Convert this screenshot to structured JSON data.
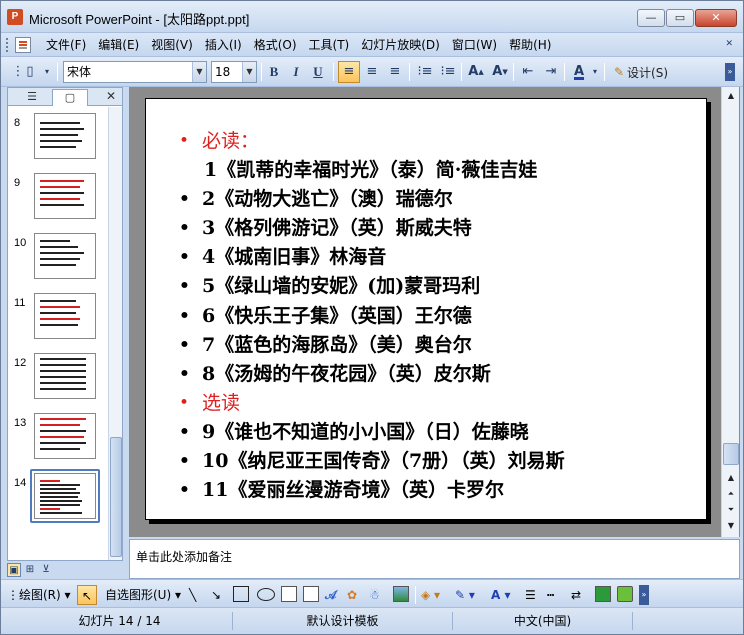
{
  "window": {
    "title": "Microsoft PowerPoint - [太阳路ppt.ppt]",
    "app_icon": "P",
    "controls": {
      "minimize": "—",
      "maximize": "▭",
      "close": "✕"
    }
  },
  "menu": {
    "items": [
      "文件(F)",
      "编辑(E)",
      "视图(V)",
      "插入(I)",
      "格式(O)",
      "工具(T)",
      "幻灯片放映(D)",
      "窗口(W)",
      "帮助(H)"
    ]
  },
  "toolbar": {
    "font": "宋体",
    "size": "18",
    "bold": "B",
    "italic": "I",
    "underline": "U",
    "design_label": "设计(S)",
    "font_color": "#1f3fb0"
  },
  "left_panel": {
    "tab_outline_icon": "outline-icon",
    "tab_slides_icon": "slides-icon",
    "close": "✕",
    "thumbnails": [
      {
        "num": "8"
      },
      {
        "num": "9"
      },
      {
        "num": "10"
      },
      {
        "num": "11"
      },
      {
        "num": "12"
      },
      {
        "num": "13"
      },
      {
        "num": "14",
        "selected": true
      }
    ]
  },
  "slide": {
    "lines": [
      {
        "text": "必读：",
        "style": "red"
      },
      {
        "text": "1《凯蒂的幸福时光》（泰）简·薇佳吉娃",
        "style": "nodot"
      },
      {
        "text": "2《动物大逃亡》（澳）瑞德尔",
        "style": "bullet"
      },
      {
        "text": "3《格列佛游记》（英）斯威夫特",
        "style": "bullet"
      },
      {
        "text": "4《城南旧事》林海音",
        "style": "bullet"
      },
      {
        "text": "5《绿山墙的安妮》(加)蒙哥玛利",
        "style": "bullet"
      },
      {
        "text": "6《快乐王子集》（英国）王尔德",
        "style": "bullet"
      },
      {
        "text": "7《蓝色的海豚岛》（美）奥台尔",
        "style": "bullet"
      },
      {
        "text": "8《汤姆的午夜花园》（英）皮尔斯",
        "style": "bullet"
      },
      {
        "text": "选读",
        "style": "red"
      },
      {
        "text": " 9《谁也不知道的小小国》（日）佐藤晓",
        "style": "bullet"
      },
      {
        "text": "10《纳尼亚王国传奇》（7册）（英）刘易斯",
        "style": "bullet"
      },
      {
        "text": "11《爱丽丝漫游奇境》（英）卡罗尔",
        "style": "bullet"
      }
    ]
  },
  "notes": {
    "placeholder": "单击此处添加备注"
  },
  "drawbar": {
    "draw_label": "绘图(R)",
    "autoshapes_label": "自选图形(U)"
  },
  "status": {
    "slide_info": "幻灯片 14 / 14",
    "design": "默认设计模板",
    "language": "中文(中国)"
  }
}
